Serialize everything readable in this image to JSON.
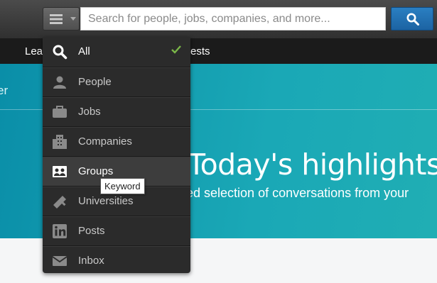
{
  "header": {
    "search_placeholder": "Search for people, jobs, companies, and more...",
    "type_button_icon": "menu-icon",
    "search_button_icon": "search-icon",
    "accent": "#1f6db0"
  },
  "nav": {
    "items": [
      {
        "label": "Lea"
      },
      {
        "label": "ests"
      }
    ]
  },
  "hero": {
    "left_text": "er",
    "title": "Today's highlights",
    "subtitle": "ed selection of conversations from your"
  },
  "dropdown": {
    "items": [
      {
        "label": "All",
        "icon": "search-icon",
        "selected": true
      },
      {
        "label": "People",
        "icon": "person-icon"
      },
      {
        "label": "Jobs",
        "icon": "briefcase-icon"
      },
      {
        "label": "Companies",
        "icon": "building-icon"
      },
      {
        "label": "Groups",
        "icon": "group-icon",
        "hovered": true
      },
      {
        "label": "Universities",
        "icon": "university-icon"
      },
      {
        "label": "Posts",
        "icon": "linkedin-post-icon"
      },
      {
        "label": "Inbox",
        "icon": "envelope-icon"
      }
    ],
    "check_color": "#7ab648"
  },
  "tooltip": {
    "text": "Keyword"
  }
}
